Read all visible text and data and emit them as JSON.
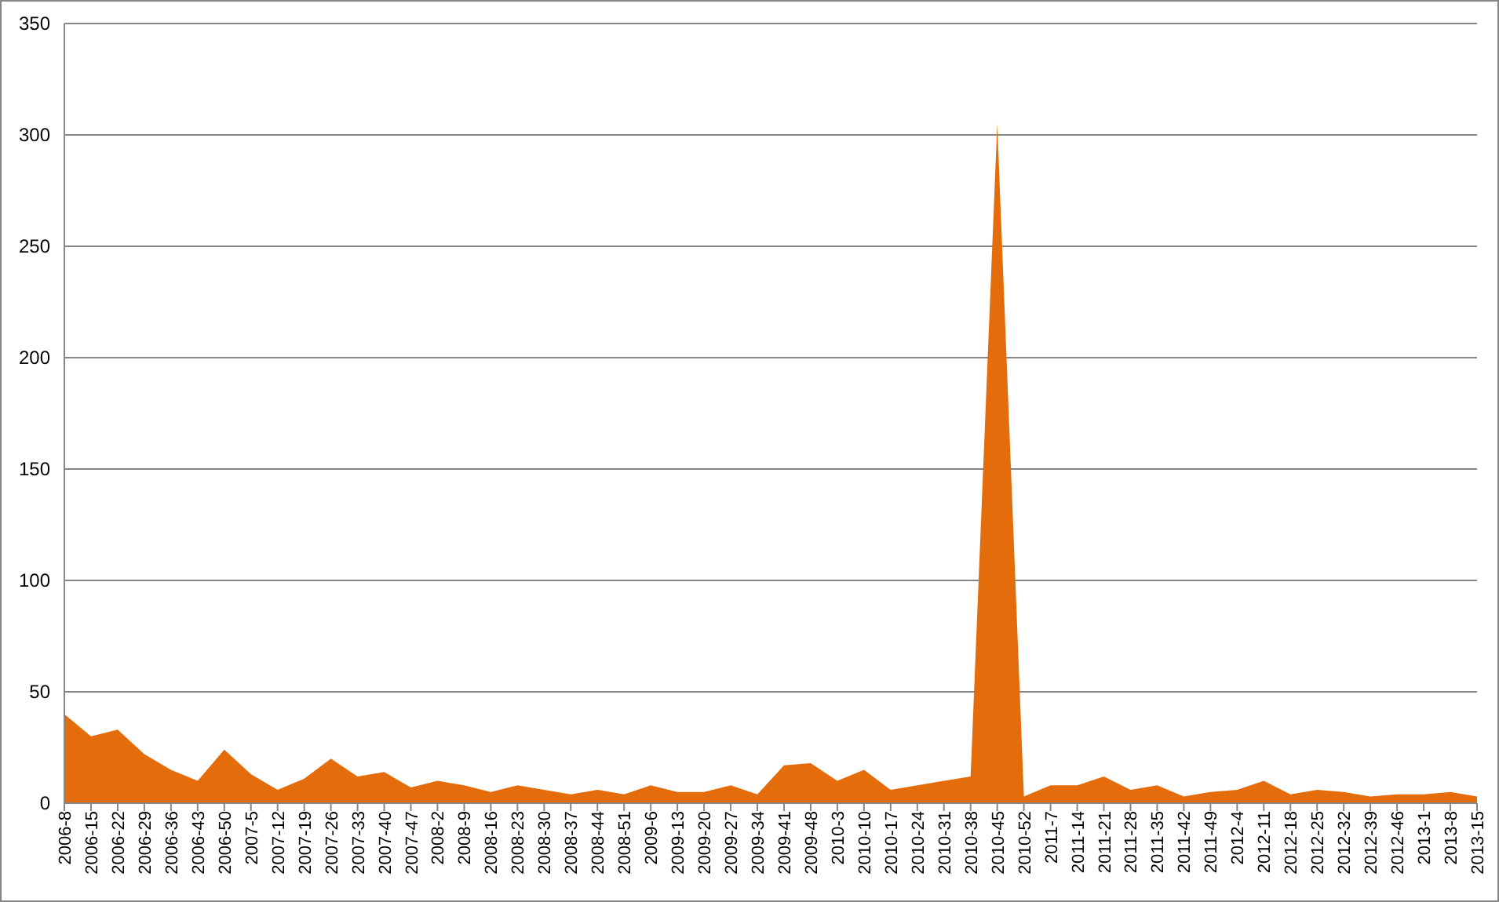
{
  "chart": {
    "chart_data": {
      "type": "area",
      "grid": true,
      "ylim": [
        0,
        350
      ],
      "yticks": [
        0,
        50,
        100,
        150,
        200,
        250,
        300,
        350
      ],
      "categories": [
        "2006-8",
        "2006-15",
        "2006-22",
        "2006-29",
        "2006-36",
        "2006-43",
        "2006-50",
        "2007-5",
        "2007-12",
        "2007-19",
        "2007-26",
        "2007-33",
        "2007-40",
        "2007-47",
        "2008-2",
        "2008-9",
        "2008-16",
        "2008-23",
        "2008-30",
        "2008-37",
        "2008-44",
        "2008-51",
        "2009-6",
        "2009-13",
        "2009-20",
        "2009-27",
        "2009-34",
        "2009-41",
        "2009-48",
        "2010-3",
        "2010-10",
        "2010-17",
        "2010-24",
        "2010-31",
        "2010-38",
        "2010-45",
        "2010-52",
        "2011-7",
        "2011-14",
        "2011-21",
        "2011-28",
        "2011-35",
        "2011-42",
        "2011-49",
        "2012-4",
        "2012-11",
        "2012-18",
        "2012-25",
        "2012-32",
        "2012-39",
        "2012-46",
        "2013-1",
        "2013-8",
        "2013-15"
      ],
      "series": [
        {
          "color": "#e46c0a",
          "values": [
            40,
            30,
            33,
            22,
            15,
            10,
            24,
            13,
            6,
            11,
            20,
            12,
            14,
            7,
            10,
            8,
            5,
            8,
            6,
            4,
            6,
            4,
            8,
            5,
            5,
            8,
            4,
            17,
            18,
            10,
            15,
            6,
            8,
            10,
            12,
            305,
            3,
            8,
            8,
            12,
            6,
            8,
            3,
            5,
            6,
            10,
            4,
            6,
            5,
            3,
            4,
            4,
            5,
            3
          ]
        }
      ]
    }
  }
}
